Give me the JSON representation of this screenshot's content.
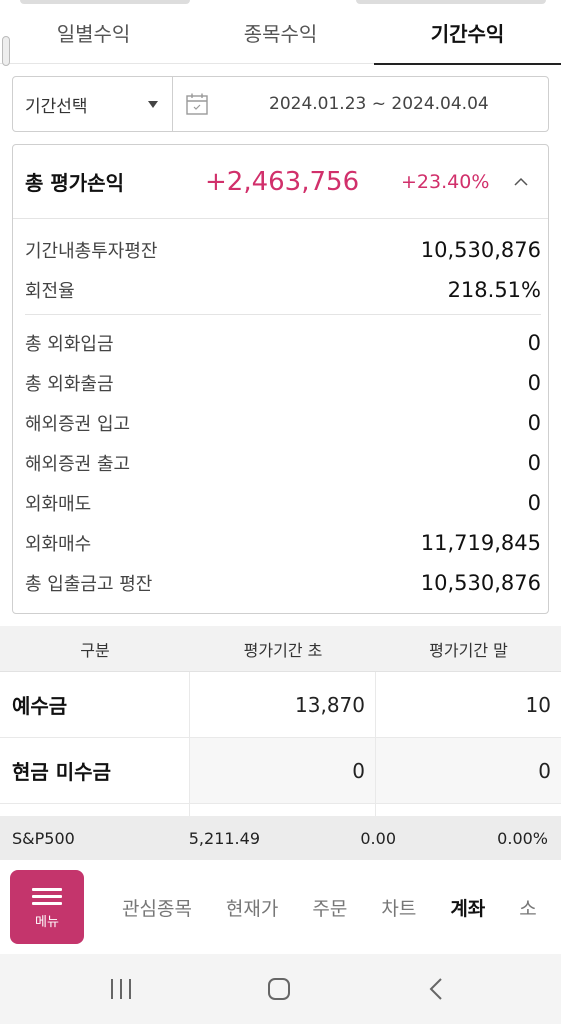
{
  "tabs": [
    {
      "label": "일별수익",
      "active": false
    },
    {
      "label": "종목수익",
      "active": false
    },
    {
      "label": "기간수익",
      "active": true
    }
  ],
  "period": {
    "select_label": "기간선택",
    "range": "2024.01.23 ~ 2024.04.04"
  },
  "summary": {
    "title": "총 평가손익",
    "amount": "+2,463,756",
    "rate": "+23.40%",
    "rows_a": [
      {
        "label": "기간내총투자평잔",
        "value": "10,530,876"
      },
      {
        "label": "회전율",
        "value": "218.51%"
      }
    ],
    "rows_b": [
      {
        "label": "총 외화입금",
        "value": "0"
      },
      {
        "label": "총 외화출금",
        "value": "0"
      },
      {
        "label": "해외증권 입고",
        "value": "0"
      },
      {
        "label": "해외증권 출고",
        "value": "0"
      },
      {
        "label": "외화매도",
        "value": "0"
      },
      {
        "label": "외화매수",
        "value": "11,719,845"
      },
      {
        "label": "총 입출금고 평잔",
        "value": "10,530,876"
      }
    ]
  },
  "table": {
    "headers": [
      "구분",
      "평가기간 초",
      "평가기간 말"
    ],
    "rows": [
      {
        "label": "예수금",
        "start": "13,870",
        "end": "10"
      },
      {
        "label": "현금 미수금",
        "start": "0",
        "end": "0"
      }
    ]
  },
  "ticker": {
    "name": "S&P500",
    "price": "5,211.49",
    "change": "0.00",
    "percent": "0.00%"
  },
  "bottom_nav": {
    "menu_label": "메뉴",
    "items": [
      {
        "label": "관심종목",
        "active": false
      },
      {
        "label": "현재가",
        "active": false
      },
      {
        "label": "주문",
        "active": false
      },
      {
        "label": "차트",
        "active": false
      },
      {
        "label": "계좌",
        "active": true
      },
      {
        "label": "소",
        "active": false
      }
    ]
  },
  "colors": {
    "accent": "#d1306b",
    "menu_button": "#c4356c"
  },
  "icons": {
    "calendar": "calendar-icon",
    "collapse": "chevron-up-icon",
    "dropdown": "caret-down-icon",
    "menu": "hamburger-icon",
    "recents": "recents-icon",
    "home": "home-icon",
    "back": "back-icon"
  }
}
